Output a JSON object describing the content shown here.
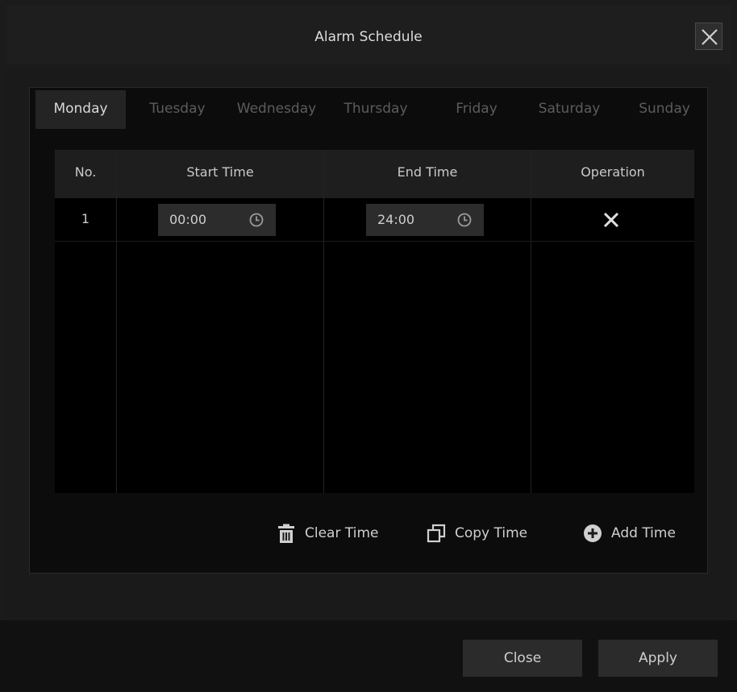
{
  "dialog": {
    "title": "Alarm Schedule"
  },
  "tabs": [
    {
      "label": "Monday",
      "active": true
    },
    {
      "label": "Tuesday",
      "active": false
    },
    {
      "label": "Wednesday",
      "active": false
    },
    {
      "label": "Thursday",
      "active": false
    },
    {
      "label": "Friday",
      "active": false
    },
    {
      "label": "Saturday",
      "active": false
    },
    {
      "label": "Sunday",
      "active": false
    }
  ],
  "table": {
    "columns": [
      "No.",
      "Start Time",
      "End Time",
      "Operation"
    ],
    "rows": [
      {
        "no": "1",
        "start_time": "00:00",
        "end_time": "24:00"
      }
    ]
  },
  "actions": {
    "clear_time": "Clear Time",
    "copy_time": "Copy Time",
    "add_time": "Add Time"
  },
  "footer": {
    "close_label": "Close",
    "apply_label": "Apply"
  },
  "icons": {
    "close": "close-icon",
    "clock": "clock-icon",
    "delete": "close-icon",
    "trash": "trash-icon",
    "copy": "copy-icon",
    "add": "plus-circle-icon"
  },
  "colors": {
    "background": "#1b1b1b",
    "panel": "#0c0c0c",
    "active_tab": "#242424",
    "text": "#c8c8c8",
    "inactive_tab_text": "#5c5c5c",
    "button": "#2b2b2b"
  }
}
